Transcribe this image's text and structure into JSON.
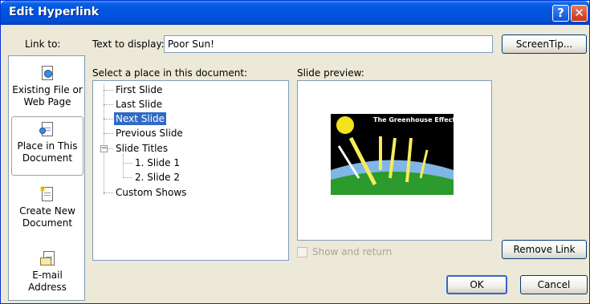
{
  "window": {
    "title": "Edit Hyperlink",
    "help_glyph": "?",
    "close_glyph": "✕"
  },
  "link_to": {
    "label": "Link to:",
    "items": [
      {
        "name": "existing-file",
        "icon": "existing-file-icon",
        "line1": "Existing File or",
        "line2": "Web Page",
        "selected": false
      },
      {
        "name": "place-in-document",
        "icon": "place-in-document-icon",
        "line1": "Place in This",
        "line2": "Document",
        "selected": true
      },
      {
        "name": "create-new-document",
        "icon": "new-document-icon",
        "line1": "Create New",
        "line2": "Document",
        "selected": false
      },
      {
        "name": "email-address",
        "icon": "email-icon",
        "line1": "E-mail Address",
        "line2": "",
        "selected": false
      }
    ]
  },
  "text_to_display": {
    "label": "Text to display:",
    "value": "Poor Sun!"
  },
  "screentip_button": "ScreenTip...",
  "select_place": {
    "label": "Select a place in this document:",
    "tree": {
      "first_slide": "First Slide",
      "last_slide": "Last Slide",
      "next_slide": "Next Slide",
      "previous_slide": "Previous Slide",
      "slide_titles": "Slide Titles",
      "slide_1": "1. Slide 1",
      "slide_2": "2. Slide 2",
      "custom_shows": "Custom Shows",
      "selected": "Next Slide",
      "expander_glyph": "−"
    }
  },
  "slide_preview": {
    "label": "Slide preview:",
    "slide_title": "The Greenhouse Effect"
  },
  "show_and_return": {
    "label": "Show and return",
    "checked": false,
    "enabled": false
  },
  "buttons": {
    "remove_link": "Remove Link",
    "ok": "OK",
    "cancel": "Cancel"
  },
  "colors": {
    "titlebar": "#0054e3",
    "selection": "#316ac5",
    "dialog_bg": "#ece9d8"
  }
}
